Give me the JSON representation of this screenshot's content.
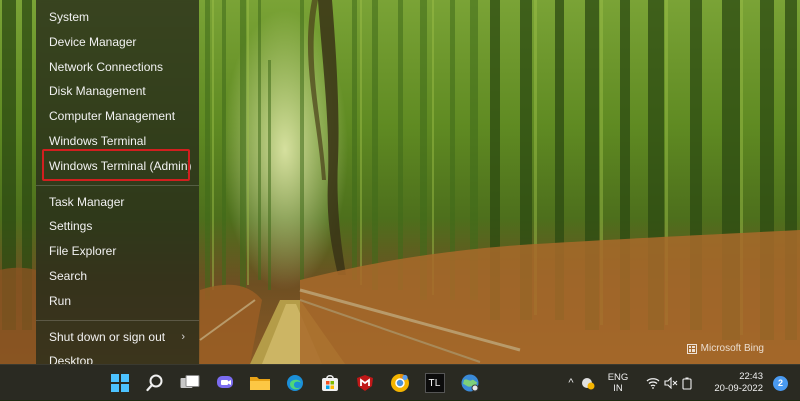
{
  "menu": {
    "items": [
      {
        "label": "System"
      },
      {
        "label": "Device Manager"
      },
      {
        "label": "Network Connections"
      },
      {
        "label": "Disk Management"
      },
      {
        "label": "Computer Management"
      },
      {
        "label": "Windows Terminal"
      },
      {
        "label": "Windows Terminal (Admin)"
      },
      {
        "label": "Task Manager"
      },
      {
        "label": "Settings"
      },
      {
        "label": "File Explorer"
      },
      {
        "label": "Search"
      },
      {
        "label": "Run"
      },
      {
        "label": "Shut down or sign out",
        "arrow": "›"
      },
      {
        "label": "Desktop"
      }
    ]
  },
  "wallpaper": {
    "watermark": "Microsoft Bing"
  },
  "taskbar": {
    "apps": [
      {
        "name": "start-icon"
      },
      {
        "name": "search-icon"
      },
      {
        "name": "task-view-icon"
      },
      {
        "name": "chat-icon"
      },
      {
        "name": "file-explorer-icon"
      },
      {
        "name": "edge-icon"
      },
      {
        "name": "store-icon"
      },
      {
        "name": "mcafee-icon"
      },
      {
        "name": "chrome-canary-icon"
      },
      {
        "name": "terminal-icon",
        "text": "TL"
      },
      {
        "name": "network-globe-icon"
      }
    ],
    "tray": {
      "overflow": "^",
      "language_line1": "ENG",
      "language_line2": "IN",
      "time": "22:43",
      "date": "20-09-2022",
      "notification_count": "2"
    }
  },
  "colors": {
    "highlight": "#d21f1f",
    "accent": "#4a9af0"
  }
}
